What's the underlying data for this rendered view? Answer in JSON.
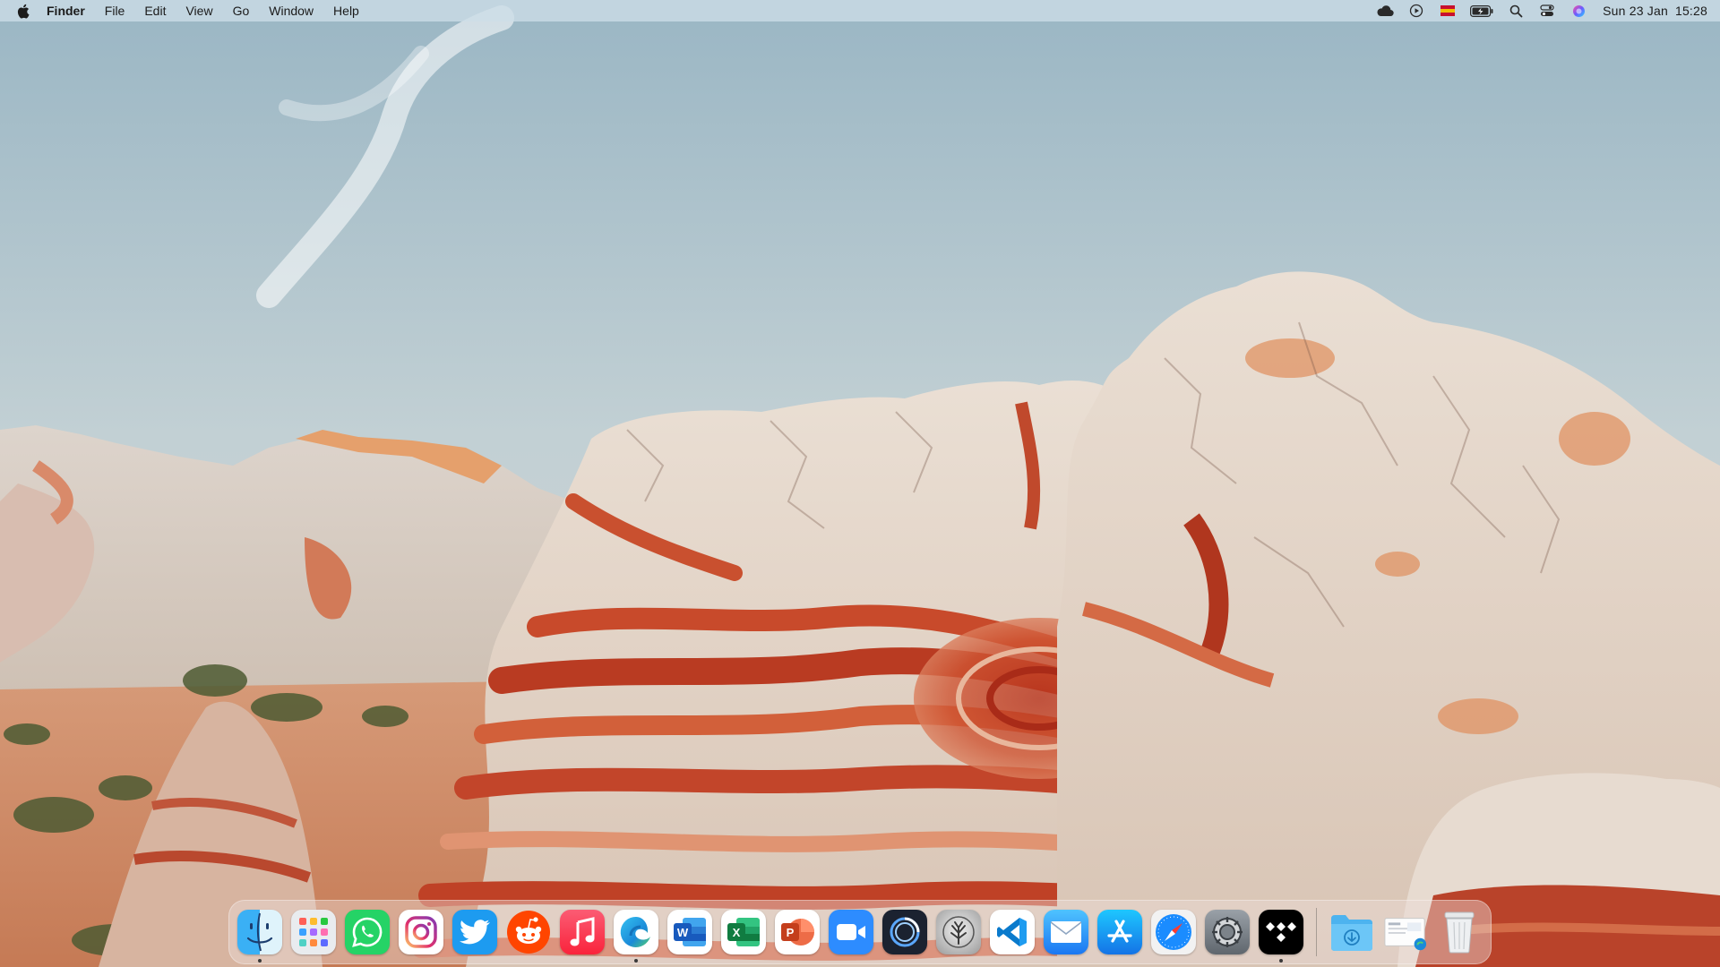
{
  "menubar": {
    "app_name": "Finder",
    "menus": [
      "File",
      "Edit",
      "View",
      "Go",
      "Window",
      "Help"
    ],
    "status_icons": [
      "icloud-icon",
      "play-circle-icon",
      "flag-icon",
      "battery-charging-icon",
      "spotlight-search-icon",
      "control-center-icon",
      "siri-icon"
    ],
    "clock": {
      "date": "Sun 23 Jan",
      "time": "15:28"
    }
  },
  "dock": {
    "apps": [
      {
        "name": "Finder",
        "icon": "finder-icon",
        "running": true
      },
      {
        "name": "Launchpad",
        "icon": "launchpad-icon",
        "running": false
      },
      {
        "name": "WhatsApp",
        "icon": "whatsapp-icon",
        "running": false
      },
      {
        "name": "Instagram",
        "icon": "instagram-icon",
        "running": false
      },
      {
        "name": "Twitter",
        "icon": "twitter-icon",
        "running": false
      },
      {
        "name": "Reddit",
        "icon": "reddit-icon",
        "running": false
      },
      {
        "name": "Music",
        "icon": "music-icon",
        "running": false
      },
      {
        "name": "Microsoft Edge",
        "icon": "edge-icon",
        "running": true
      },
      {
        "name": "Microsoft Word",
        "icon": "word-icon",
        "running": false
      },
      {
        "name": "Microsoft Excel",
        "icon": "excel-icon",
        "running": false
      },
      {
        "name": "Microsoft PowerPoint",
        "icon": "powerpoint-icon",
        "running": false
      },
      {
        "name": "Zoom",
        "icon": "zoom-icon",
        "running": false
      },
      {
        "name": "Cortex",
        "icon": "ring-app-icon",
        "running": false
      },
      {
        "name": "Tree App",
        "icon": "tree-app-icon",
        "running": false
      },
      {
        "name": "Visual Studio Code",
        "icon": "vscode-icon",
        "running": false
      },
      {
        "name": "Mail",
        "icon": "mail-icon",
        "running": false
      },
      {
        "name": "App Store",
        "icon": "app-store-icon",
        "running": false
      },
      {
        "name": "Safari",
        "icon": "safari-icon",
        "running": false
      },
      {
        "name": "System Preferences",
        "icon": "system-preferences-icon",
        "running": false
      },
      {
        "name": "Tidal",
        "icon": "tidal-icon",
        "running": true
      }
    ],
    "stacks": [
      {
        "name": "Downloads",
        "icon": "downloads-folder-icon"
      },
      {
        "name": "Document",
        "icon": "document-thumbnail-icon"
      },
      {
        "name": "Trash",
        "icon": "trash-icon"
      }
    ]
  },
  "colors": {
    "menubar_bg": "#cddee8",
    "sky": "#b6c9d0",
    "rock_white": "#e4d6ca",
    "rock_red": "#c9472a"
  }
}
